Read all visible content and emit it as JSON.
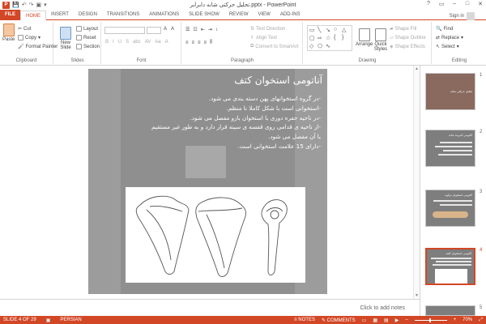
{
  "window": {
    "title": "تحلیل حرکتی شانه دابرابر.pptx - PowerPoint",
    "controls": [
      "?",
      "▭",
      "–",
      "□",
      "✕"
    ]
  },
  "ribbon": {
    "tabs": [
      "FILE",
      "HOME",
      "INSERT",
      "DESIGN",
      "TRANSITIONS",
      "ANIMATIONS",
      "SLIDE SHOW",
      "REVIEW",
      "VIEW",
      "ADD-INS"
    ],
    "active_tab": "HOME",
    "signin": "Sign in",
    "clipboard": {
      "label": "Clipboard",
      "paste": "Paste",
      "cut": "Cut",
      "copy": "Copy",
      "format_painter": "Format Painter"
    },
    "slides": {
      "label": "Slides",
      "new_slide": "New Slide",
      "layout": "Layout",
      "reset": "Reset",
      "section": "Section"
    },
    "font": {
      "label": "Font"
    },
    "paragraph": {
      "label": "Paragraph",
      "text_direction": "Text Direction",
      "align_text": "Align Text",
      "convert_smartart": "Convert to SmartArt"
    },
    "drawing": {
      "label": "Drawing",
      "arrange": "Arrange",
      "quick_styles": "Quick Styles",
      "shape_fill": "Shape Fill",
      "shape_outline": "Shape Outline",
      "shape_effects": "Shape Effects"
    },
    "editing": {
      "label": "Editing",
      "find": "Find",
      "replace": "Replace",
      "select": "Select"
    }
  },
  "slide": {
    "title": "آناتومی استخوان کتف",
    "bullets": [
      "-در گروه استخوانهای پهن دسته بندی می شود.",
      "-استخوانی است با شکل کاملا نا منظم.",
      "-در ناحیه حفره دوری با استخوان بازو مفصل می شود.",
      "-از ناحیه ی قدامی روی قفسه ی سینه قرار دارد و به طور غیر مستقیم",
      "با آن مفصل می شود.",
      "-دارای 15 علامت استخوانی است."
    ]
  },
  "notes": {
    "placeholder": "Click to add notes"
  },
  "thumbnails": [
    {
      "num": "1",
      "text": "تحلیل حرکتی شانه"
    },
    {
      "num": "2",
      "text": "آناتومی کمربند شانه"
    },
    {
      "num": "3",
      "text": "آناتومی استخوان ترقوه"
    },
    {
      "num": "4",
      "text": "آناتومی استخوان کتف"
    },
    {
      "num": "5",
      "text": ""
    }
  ],
  "status": {
    "slide_info": "SLIDE 4 OF 29",
    "language": "PERSIAN",
    "notes": "NOTES",
    "comments": "COMMENTS",
    "zoom": "70%"
  },
  "colors": {
    "accent": "#d24726",
    "slide_bg": "#8f8f8f"
  }
}
